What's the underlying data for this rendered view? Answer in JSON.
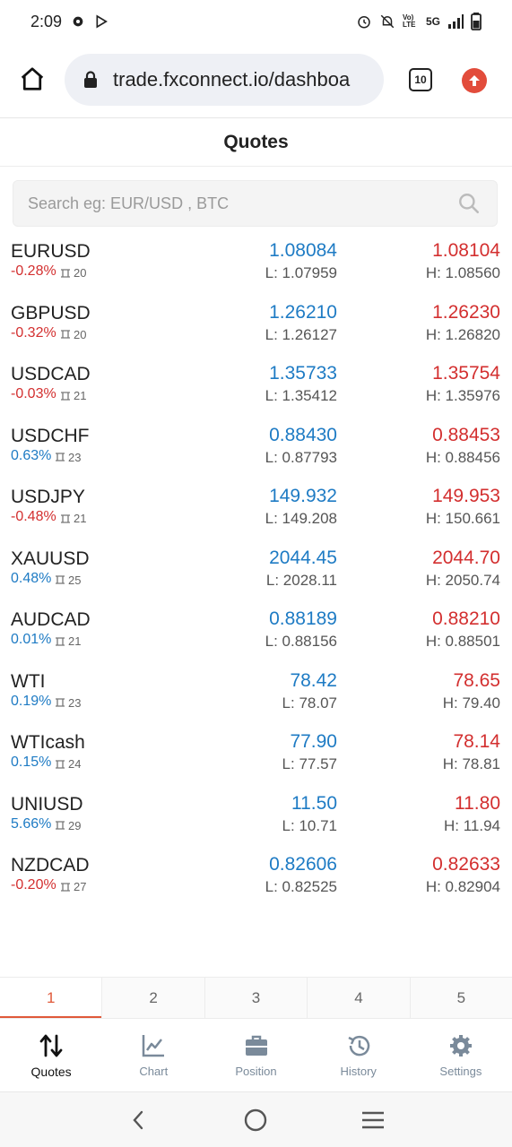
{
  "status_bar": {
    "time": "2:09",
    "network": "5G",
    "volte": "Vo) LTE"
  },
  "browser": {
    "url": "trade.fxconnect.io/dashboa",
    "tab_count": "10"
  },
  "header": {
    "title": "Quotes"
  },
  "search": {
    "placeholder": "Search eg: EUR/USD , BTC"
  },
  "quotes": [
    {
      "symbol": "EURUSD",
      "change": "-0.28%",
      "direction": "neg",
      "spread": "20",
      "bid": "1.08084",
      "ask": "1.08104",
      "low": "L: 1.07959",
      "high": "H: 1.08560"
    },
    {
      "symbol": "GBPUSD",
      "change": "-0.32%",
      "direction": "neg",
      "spread": "20",
      "bid": "1.26210",
      "ask": "1.26230",
      "low": "L: 1.26127",
      "high": "H: 1.26820"
    },
    {
      "symbol": "USDCAD",
      "change": "-0.03%",
      "direction": "neg",
      "spread": "21",
      "bid": "1.35733",
      "ask": "1.35754",
      "low": "L: 1.35412",
      "high": "H: 1.35976"
    },
    {
      "symbol": "USDCHF",
      "change": "0.63%",
      "direction": "pos",
      "spread": "23",
      "bid": "0.88430",
      "ask": "0.88453",
      "low": "L: 0.87793",
      "high": "H: 0.88456"
    },
    {
      "symbol": "USDJPY",
      "change": "-0.48%",
      "direction": "neg",
      "spread": "21",
      "bid": "149.932",
      "ask": "149.953",
      "low": "L: 149.208",
      "high": "H: 150.661"
    },
    {
      "symbol": "XAUUSD",
      "change": "0.48%",
      "direction": "pos",
      "spread": "25",
      "bid": "2044.45",
      "ask": "2044.70",
      "low": "L: 2028.11",
      "high": "H: 2050.74"
    },
    {
      "symbol": "AUDCAD",
      "change": "0.01%",
      "direction": "pos",
      "spread": "21",
      "bid": "0.88189",
      "ask": "0.88210",
      "low": "L: 0.88156",
      "high": "H: 0.88501"
    },
    {
      "symbol": "WTI",
      "change": "0.19%",
      "direction": "pos",
      "spread": "23",
      "bid": "78.42",
      "ask": "78.65",
      "low": "L: 78.07",
      "high": "H: 79.40"
    },
    {
      "symbol": "WTIcash",
      "change": "0.15%",
      "direction": "pos",
      "spread": "24",
      "bid": "77.90",
      "ask": "78.14",
      "low": "L: 77.57",
      "high": "H: 78.81"
    },
    {
      "symbol": "UNIUSD",
      "change": "5.66%",
      "direction": "pos",
      "spread": "29",
      "bid": "11.50",
      "ask": "11.80",
      "low": "L: 10.71",
      "high": "H: 11.94"
    },
    {
      "symbol": "NZDCAD",
      "change": "-0.20%",
      "direction": "neg",
      "spread": "27",
      "bid": "0.82606",
      "ask": "0.82633",
      "low": "L: 0.82525",
      "high": "H: 0.82904"
    }
  ],
  "pager": {
    "pages": [
      "1",
      "2",
      "3",
      "4",
      "5"
    ],
    "active": "1"
  },
  "bottom_nav": [
    {
      "label": "Quotes",
      "icon": "sort-arrows-icon",
      "active": true
    },
    {
      "label": "Chart",
      "icon": "line-chart-icon",
      "active": false
    },
    {
      "label": "Position",
      "icon": "briefcase-icon",
      "active": false
    },
    {
      "label": "History",
      "icon": "history-icon",
      "active": false
    },
    {
      "label": "Settings",
      "icon": "gear-icon",
      "active": false
    }
  ],
  "colors": {
    "bid": "#1e7bc4",
    "ask": "#d32f2f",
    "accent": "#e0593a",
    "nav_inactive": "#7a8a9a"
  }
}
